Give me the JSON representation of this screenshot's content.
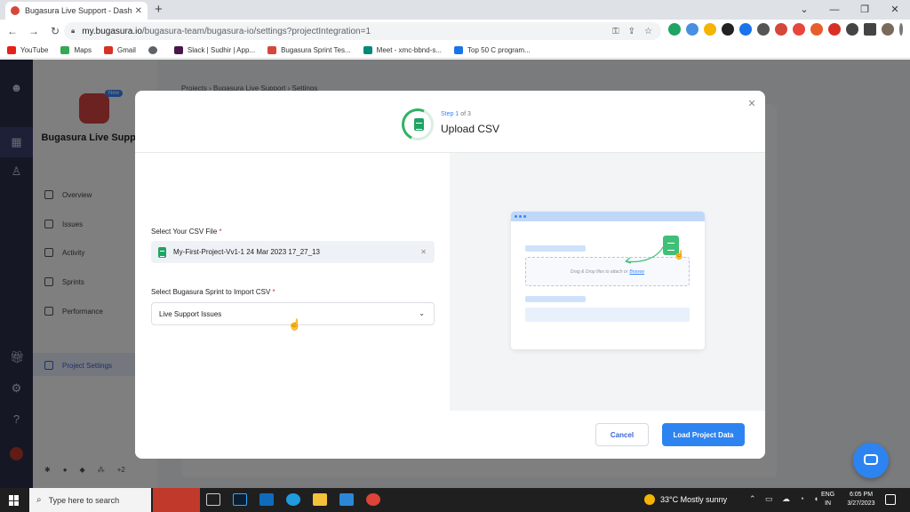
{
  "browser": {
    "tab_title": "Bugasura Live Support - Dashbo",
    "url_host": "my.bugasura.io",
    "url_path": "/bugasura-team/bugasura-io/settings?projectIntegration=1",
    "bookmarks": [
      {
        "label": "YouTube",
        "color": "#e62117"
      },
      {
        "label": "Maps",
        "color": "#34a853"
      },
      {
        "label": "Gmail",
        "color": "#d93025"
      },
      {
        "label": "",
        "color": "#5f6368"
      },
      {
        "label": "Slack | Sudhir | App...",
        "color": "#4a154b"
      },
      {
        "label": "Bugasura Sprint Tes...",
        "color": "#d4483b"
      },
      {
        "label": "Meet - xmc-bbnd-s...",
        "color": "#00897b"
      },
      {
        "label": "Top 50 C program...",
        "color": "#1a73e8"
      }
    ]
  },
  "app": {
    "brand": "Bugasura Live Support",
    "badge": "New",
    "breadcrumb": "Projects › Bugasura Live Support › Settings",
    "nav": [
      {
        "label": "Overview"
      },
      {
        "label": "Issues"
      },
      {
        "label": "Activity"
      },
      {
        "label": "Sprints"
      },
      {
        "label": "Performance"
      },
      {
        "label": "Project Settings"
      }
    ],
    "more_integrations": "+2"
  },
  "modal": {
    "step_prefix": "Step",
    "step_current": "1",
    "step_total": "of 3",
    "title": "Upload CSV",
    "file_label": "Select Your CSV File",
    "required_mark": "*",
    "file_name": "My-First-Project-Vv1-1 24 Mar 2023 17_27_13",
    "sprint_label": "Select Bugasura Sprint to Import CSV",
    "sprint_value": "Live Support Issues",
    "illustration_drop_text": "Drag & Drop files to attach or",
    "illustration_browse": "Browse",
    "cancel_label": "Cancel",
    "load_label": "Load Project Data",
    "accent_color": "#2d84f0"
  },
  "taskbar": {
    "search_placeholder": "Type here to search",
    "weather": "33°C  Mostly sunny",
    "lang_line1": "ENG",
    "lang_line2": "IN",
    "time": "6:05 PM",
    "date": "3/27/2023",
    "notif_count": "3"
  }
}
